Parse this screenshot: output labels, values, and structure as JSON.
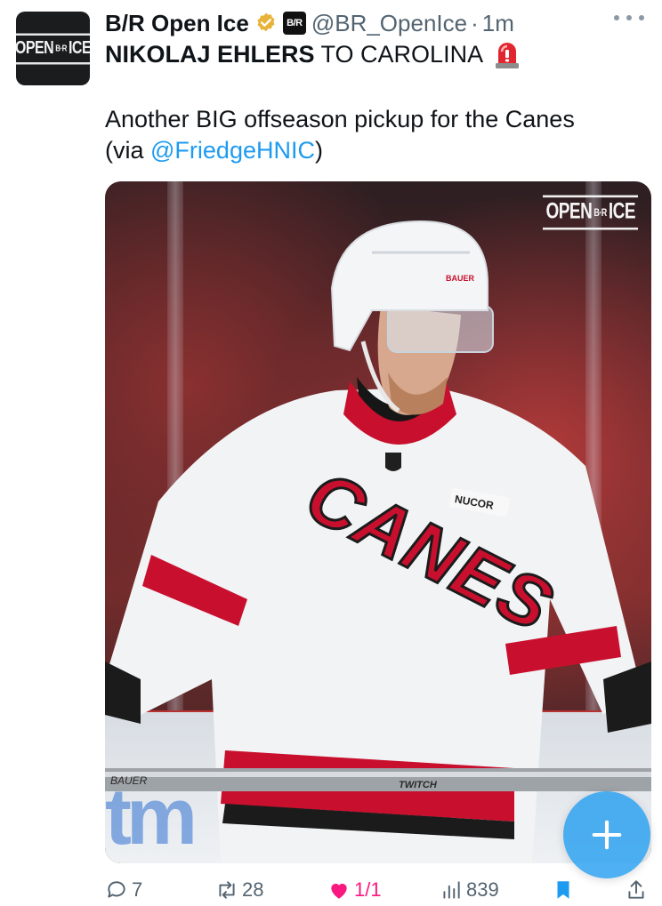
{
  "author": {
    "display_name": "B/R Open Ice",
    "org_badge": "B/R",
    "handle": "@BR_OpenIce",
    "separator": "·",
    "time": "1m",
    "avatar_logo": {
      "left": "OPEN",
      "mid": "B·R",
      "right": "ICE"
    }
  },
  "tweet": {
    "headline_bold": "NIKOLAJ EHLERS",
    "headline_rest": "TO CAROLINA",
    "body_line1": "Another BIG offseason pickup for the Canes",
    "body_prefix": "(via ",
    "mention": "@FriedgeHNIC",
    "body_suffix": ")"
  },
  "media": {
    "watermark": {
      "left": "OPEN",
      "mid": "B·R",
      "right": "ICE"
    },
    "helmet_brand": "BAUER",
    "jersey_text": "CANES",
    "sponsor_patch": "NUCOR",
    "stick_brand": "BAUER",
    "stick_model": "TWITCH",
    "rink_ad": "tm"
  },
  "actions": {
    "replies": "7",
    "reposts": "28",
    "likes": "1/1",
    "views": "839"
  },
  "colors": {
    "accent": "#1d9bf0",
    "like": "#f91880",
    "muted": "#536471",
    "canes_red": "#c8102e"
  }
}
